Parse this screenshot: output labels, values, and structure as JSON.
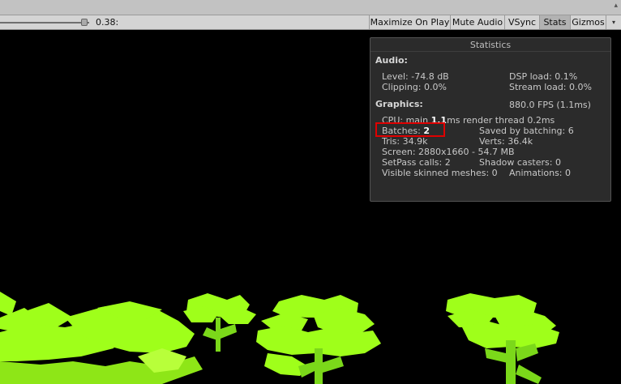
{
  "toolbar": {
    "scale_value": "0.38:",
    "maximize_on_play": "Maximize On Play",
    "mute_audio": "Mute Audio",
    "vsync": "VSync",
    "stats": "Stats",
    "gizmos": "Gizmos",
    "gizmos_dropdown": "▾"
  },
  "stats": {
    "title": "Statistics",
    "audio_header": "Audio:",
    "level": "Level: -74.8 dB",
    "dsp_load": "DSP load: 0.1%",
    "clipping": "Clipping: 0.0%",
    "stream_load": "Stream load: 0.0%",
    "graphics_header": "Graphics:",
    "fps": "880.0 FPS (1.1ms)",
    "cpu_prefix": "CPU: main ",
    "cpu_main": "1.1",
    "cpu_suffix": "ms  render thread 0.2ms",
    "batches_label": "Batches: ",
    "batches_value": "2",
    "saved_by_batching": "Saved by batching: 6",
    "tris": "Tris: 34.9k",
    "verts": "Verts: 36.4k",
    "screen": "Screen: 2880x1660 - 54.7 MB",
    "setpass_calls": "SetPass calls: 2",
    "shadow_casters": "Shadow casters: 0",
    "skinned_meshes": "Visible skinned meshes: 0",
    "animations": "Animations: 0"
  },
  "scene": {
    "background_color": "#000000",
    "foliage_color": "#9fff1a",
    "trunk_color": "#7bd81a"
  }
}
